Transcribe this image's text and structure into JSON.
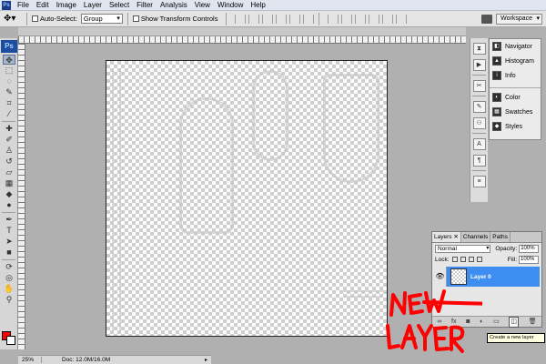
{
  "menu": {
    "app_icon": "Ps",
    "items": [
      "File",
      "Edit",
      "Image",
      "Layer",
      "Select",
      "Filter",
      "Analysis",
      "View",
      "Window",
      "Help"
    ]
  },
  "options_bar": {
    "auto_select_label": "Auto-Select:",
    "auto_select_value": "Group",
    "show_transform_label": "Show Transform Controls",
    "workspace_label": "Workspace"
  },
  "toolbox": {
    "logo": "Ps",
    "tools": [
      "move",
      "marquee",
      "lasso",
      "quick-select",
      "crop",
      "eyedropper",
      "healing",
      "brush",
      "stamp",
      "history-brush",
      "eraser",
      "gradient",
      "blur",
      "dodge",
      "pen",
      "type",
      "path-select",
      "shape",
      "3d-rotate",
      "3d-orbit",
      "hand",
      "zoom"
    ],
    "foreground_color": "#ff0000",
    "background_color": "#ffffff"
  },
  "status": {
    "zoom": "25%",
    "doc_info": "Doc: 12.0M/16.0M"
  },
  "dock_panels": {
    "group1": [
      "Navigator",
      "Histogram",
      "Info"
    ],
    "group2": [
      "Color",
      "Swatches",
      "Styles"
    ]
  },
  "layers_panel": {
    "tabs": [
      "Layers",
      "Channels",
      "Paths"
    ],
    "blend_mode": "Normal",
    "opacity_label": "Opacity:",
    "opacity_value": "100%",
    "lock_label": "Lock:",
    "fill_label": "Fill:",
    "fill_value": "100%",
    "layer_name": "Layer 0",
    "bottom_icons": [
      "link-icon",
      "fx-icon",
      "mask-icon",
      "adjustment-icon",
      "group-icon",
      "new-layer-icon",
      "trash-icon"
    ]
  },
  "tooltip": "Create a new layer",
  "annotation": {
    "line1": "NEW",
    "line2": "LAYER",
    "color": "#ff0000"
  }
}
